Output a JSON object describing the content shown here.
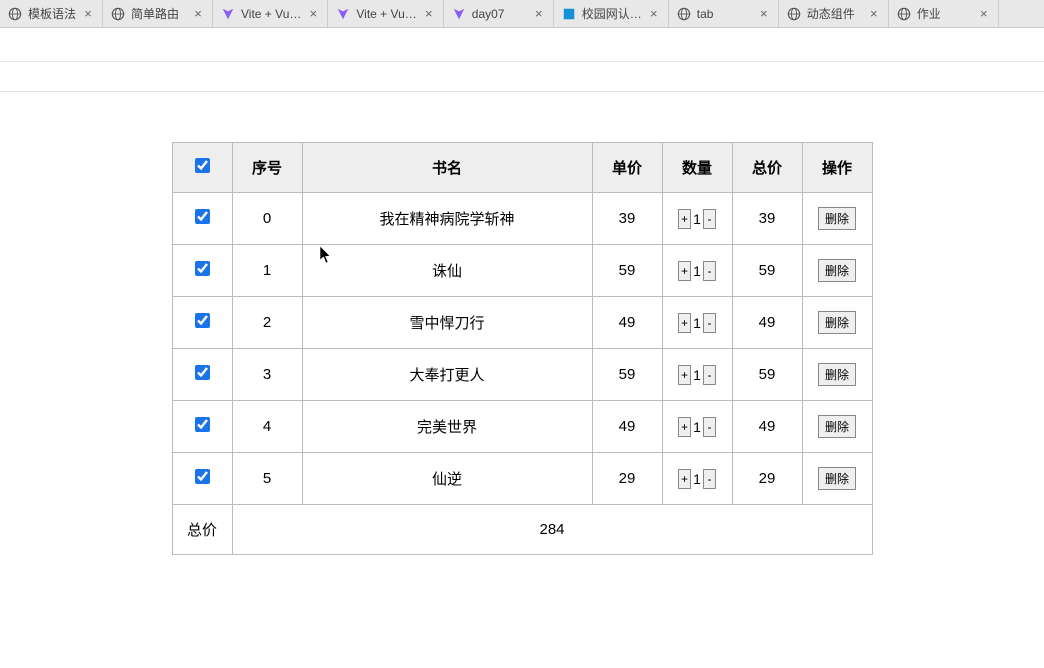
{
  "tabs": [
    {
      "title": "模板语法",
      "icon": "globe"
    },
    {
      "title": "简单路由",
      "icon": "globe"
    },
    {
      "title": "Vite + Vu…",
      "icon": "vite"
    },
    {
      "title": "Vite + Vu…",
      "icon": "vite"
    },
    {
      "title": "day07",
      "icon": "vite"
    },
    {
      "title": "校园网认…",
      "icon": "campus"
    },
    {
      "title": "tab",
      "icon": "globe"
    },
    {
      "title": "动态组件",
      "icon": "globe"
    },
    {
      "title": "作业",
      "icon": "globe"
    }
  ],
  "table": {
    "headers": {
      "index": "序号",
      "name": "书名",
      "price": "单价",
      "qty": "数量",
      "total": "总价",
      "action": "操作"
    },
    "rows": [
      {
        "index": "0",
        "name": "我在精神病院学斩神",
        "price": "39",
        "qty": "1",
        "total": "39",
        "checked": true
      },
      {
        "index": "1",
        "name": "诛仙",
        "price": "59",
        "qty": "1",
        "total": "59",
        "checked": true
      },
      {
        "index": "2",
        "name": "雪中悍刀行",
        "price": "49",
        "qty": "1",
        "total": "49",
        "checked": true
      },
      {
        "index": "3",
        "name": "大奉打更人",
        "price": "59",
        "qty": "1",
        "total": "59",
        "checked": true
      },
      {
        "index": "4",
        "name": "完美世界",
        "price": "49",
        "qty": "1",
        "total": "49",
        "checked": true
      },
      {
        "index": "5",
        "name": "仙逆",
        "price": "29",
        "qty": "1",
        "total": "29",
        "checked": true
      }
    ],
    "buttons": {
      "plus": "+",
      "minus": "-",
      "delete": "删除"
    },
    "grand_label": "总价",
    "grand_total": "284"
  }
}
